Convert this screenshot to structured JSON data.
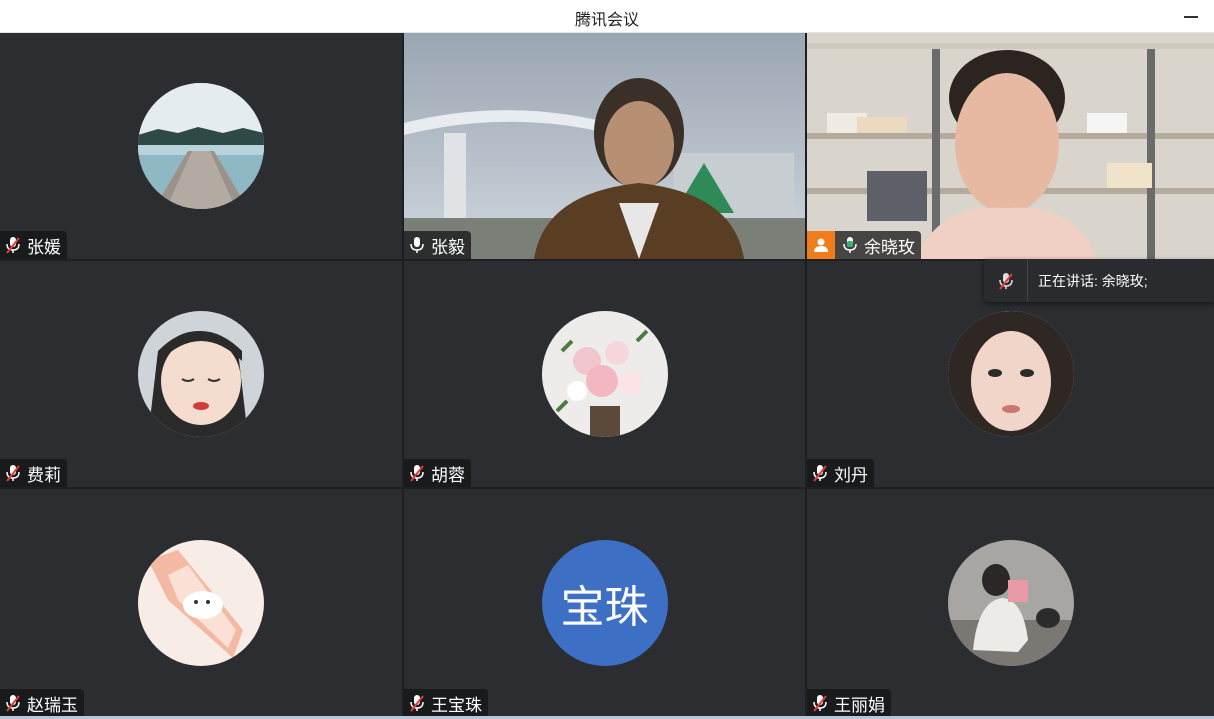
{
  "window": {
    "title": "腾讯会议"
  },
  "participants": [
    {
      "name": "张媛",
      "mic": "muted",
      "avatar": "landscape-pier"
    },
    {
      "name": "张毅",
      "mic": "on",
      "avatar": "video-man"
    },
    {
      "name": "余晓玫",
      "mic": "speaking",
      "avatar": "video-woman",
      "host": true
    },
    {
      "name": "费莉",
      "mic": "muted",
      "avatar": "photo-child"
    },
    {
      "name": "胡蓉",
      "mic": "muted",
      "avatar": "photo-flowers"
    },
    {
      "name": "刘丹",
      "mic": "muted",
      "avatar": "photo-woman"
    },
    {
      "name": "赵瑞玉",
      "mic": "muted",
      "avatar": "drawing-rabbit-candy"
    },
    {
      "name": "王宝珠",
      "mic": "muted",
      "avatar_text": "宝珠",
      "avatar_color": "#3d6fc4"
    },
    {
      "name": "王丽娟",
      "mic": "muted",
      "avatar": "photo-woman-sitting"
    }
  ],
  "speaking_popup": {
    "text": "正在讲话:  余晓玫;"
  },
  "colors": {
    "active_border": "#3bb273",
    "host_badge": "#f07d1a",
    "speaking_mic": "#3bb273"
  }
}
